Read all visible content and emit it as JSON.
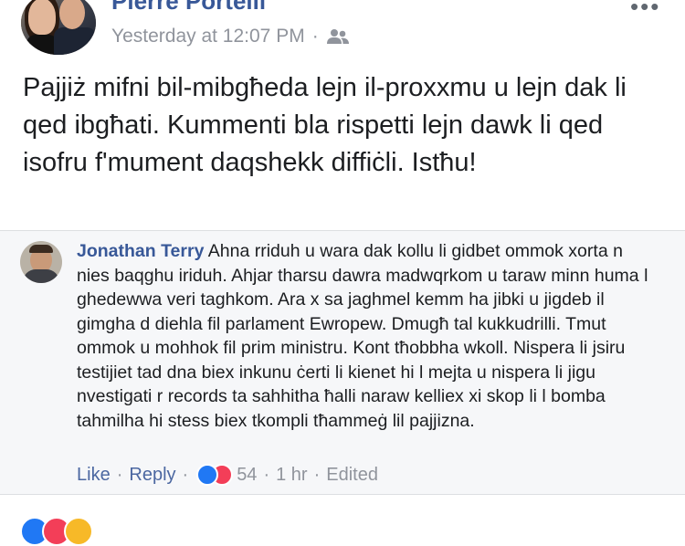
{
  "post": {
    "author": "Pierre Portelli",
    "timestamp": "Yesterday at 12:07 PM",
    "separator": "·",
    "audience_icon": "friends-icon",
    "more_icon": "more-options-icon",
    "more_glyph": "•••",
    "text": "Pajjiż mifni bil-mibgħeda lejn il-proxxmu u lejn dak li qed ibgħati. Kummenti bla rispetti lejn dawk li qed isofru f'mument daqshekk diffiċli. Istħu!"
  },
  "comment": {
    "author": "Jonathan Terry",
    "text": " Ahna rriduh u wara dak kollu li gidbet ommok xorta n nies baqghu iriduh. Ahjar tharsu dawra madwqrkom u taraw minn huma l ghedewwa veri taghkom. Ara x sa jaghmel kemm ha jibki u jigdeb il gimgha d diehla fil parlament Ewropew. Dmugħ tal kukkudrilli. Tmut ommok u mohhok fil prim ministru. Kont tħobbha wkoll. Nispera li jsiru testijiet tad dna biex inkunu ċerti li kienet hi l mejta u nispera li jigu nvestigati r records ta sahhitha ħalli naraw kelliex xi skop li l bomba tahmilha hi stess biex tkompli tħammeġ lil pajjizna.",
    "actions": {
      "like": "Like",
      "reply": "Reply",
      "reaction_count": "54",
      "time": "1 hr",
      "edited": "Edited",
      "dot": "·"
    }
  },
  "colors": {
    "link_blue": "#385898",
    "meta_gray": "#90949c",
    "like_blue": "#2078f4",
    "love_red": "#f33e58"
  }
}
